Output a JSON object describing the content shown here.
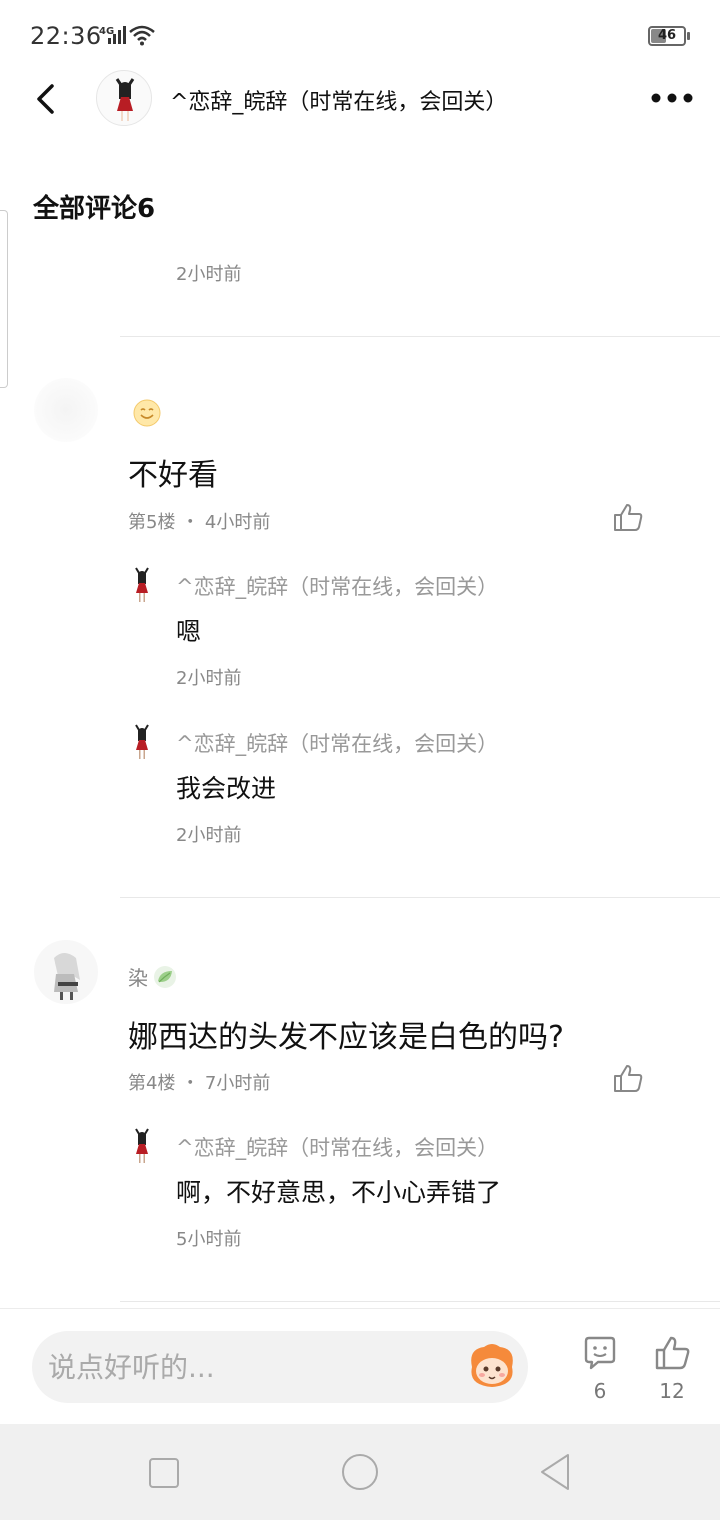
{
  "status_bar": {
    "time": "22:36",
    "network": "4G",
    "battery": "46",
    "battery_fraction": 0.46
  },
  "header": {
    "title": "^恋辞_皖辞（时常在线，会回关）"
  },
  "section": {
    "title": "全部评论6"
  },
  "top_partial": {
    "time": "2小时前"
  },
  "comments": [
    {
      "user_name": "",
      "text": "不好看",
      "floor": "第5楼",
      "time": "4小时前",
      "replies": [
        {
          "name": "^恋辞_皖辞（时常在线，会回关）",
          "text": "嗯",
          "time": "2小时前"
        },
        {
          "name": "^恋辞_皖辞（时常在线，会回关）",
          "text": "我会改进",
          "time": "2小时前"
        }
      ]
    },
    {
      "user_name": "染",
      "text": "娜西达的头发不应该是白色的吗?",
      "floor": "第4楼",
      "time": "7小时前",
      "replies": [
        {
          "name": "^恋辞_皖辞（时常在线，会回关）",
          "text": "啊，不好意思，不小心弄错了",
          "time": "5小时前"
        }
      ]
    }
  ],
  "meta_separator": "・",
  "bottom_bar": {
    "input_placeholder": "说点好听的...",
    "comment_count": "6",
    "like_count": "12"
  },
  "icons": [
    "back-icon",
    "more-icon",
    "like-icon",
    "smile-emoji-icon",
    "leaf-badge-icon",
    "mascot-icon",
    "comment-bubble-icon",
    "thumbs-up-icon",
    "nav-square-icon",
    "nav-home-icon",
    "nav-back-icon"
  ],
  "colors": {
    "text_primary": "#111111",
    "text_secondary": "#888888",
    "divider": "#e8e8e8",
    "input_bg": "#f2f2f2",
    "nav_bg": "#f0f0f0"
  }
}
